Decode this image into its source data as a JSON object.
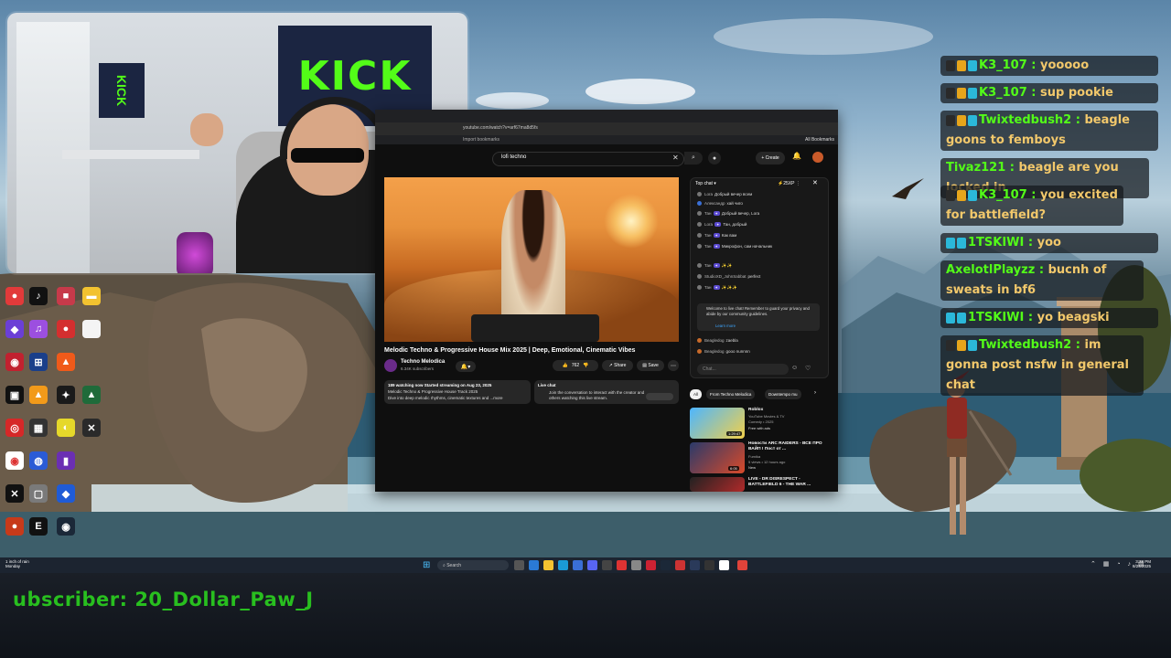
{
  "browser": {
    "url": "youtube.com/watch?v=arf67ma8d5fs",
    "bookmarks_text": "Import bookmarks",
    "all_bookmarks": "All Bookmarks"
  },
  "youtube": {
    "search_value": "lofi techno",
    "create_label": "Create",
    "video_title": "Melodic Techno & Progressive House Mix 2025 | Deep, Emotional, Cinematic Vibes",
    "channel_name": "Techno Melodica",
    "subscribers": "6.34K subscribers",
    "like_count": "762",
    "share_label": "Share",
    "save_label": "Save",
    "description": {
      "line1": "189 watching now  Started streaming on Aug 23, 2025",
      "line2": "Melodic Techno & Progressive House Track 2025",
      "line3": "Dive into deep melodic rhythms, cinematic textures and ...more"
    },
    "live_chat_box": {
      "title": "Live chat",
      "text": "Join the conversation to interact with the creator and others watching this live stream."
    },
    "chat": {
      "header": "Top chat",
      "xp": "25XP",
      "messages": [
        {
          "name": "Lora",
          "text": "Добрый вечер всем"
        },
        {
          "name": "Александр",
          "text": "хай чиго"
        },
        {
          "name": "Тан",
          "text": "Добрый вечер, Lora"
        },
        {
          "name": "Lora",
          "text": "Тан, добрый"
        },
        {
          "name": "Тан",
          "text": "Как вам"
        },
        {
          "name": "Тан",
          "text": "Микрофон, сам начальник"
        },
        {
          "name": "Тан",
          "text": "✨✨"
        },
        {
          "name": "StudioXD_JohnSabbat",
          "text": "perfect"
        },
        {
          "name": "Тан",
          "text": "✨✨✨"
        }
      ],
      "welcome": "Welcome to live chat! Remember to guard your privacy and abide by our community guidelines.",
      "learn_more": "Learn more",
      "bottom_messages": [
        {
          "name": "Beagledog",
          "text": "zaebla"
        },
        {
          "name": "Beagledog",
          "text": "gooo nunnnn"
        }
      ],
      "input_placeholder": "Chat..."
    },
    "chips": [
      "All",
      "From Techno Melodica",
      "Downtempo mu"
    ],
    "recommendations": [
      {
        "title": "Roblox",
        "meta1": "YouTube Movies & TV",
        "meta2": "Comedy • 2025",
        "meta3": "Free with ads",
        "duration": "1:29:47"
      },
      {
        "title": "Новости ARC RAIDERS - ВСЕ ПРО ВАЙП ! Пост от ...",
        "meta1": "Fumika",
        "meta2": "5 views • 12 hours ago",
        "meta3": "New",
        "duration": "6:05"
      },
      {
        "title": "LIVE - DR DISRESPECT - BATTLEFIELD 6 - THE WAR ...",
        "meta1": "",
        "meta2": "",
        "meta3": "",
        "duration": ""
      }
    ]
  },
  "stream_chat": [
    {
      "user": "K3_107",
      "msg": "yooooo"
    },
    {
      "user": "K3_107",
      "msg": "sup pookie"
    },
    {
      "user": "Twixtedbush2",
      "msg": "beagle goons to femboys"
    },
    {
      "user": "Tivaz121",
      "msg": "beagle are you locked in"
    },
    {
      "user": "K3_107",
      "msg": "you excited for battlefield?"
    },
    {
      "user": "1TSKIWI",
      "msg": "yoo"
    },
    {
      "user": "AxelotlPlayzz",
      "msg": "bucnh of sweats in bf6"
    },
    {
      "user": "1TSKIWI",
      "msg": "yo beagski"
    },
    {
      "user": "Twixtedbush2",
      "msg": "im gonna post nsfw in general chat"
    }
  ],
  "taskbar": {
    "weather_line1": "1 inch of rain",
    "weather_line2": "Monday",
    "search_label": "Search",
    "clock_time": "3:38 PM",
    "clock_date": "8/25/2025"
  },
  "webcam": {
    "banner_text": "KICK",
    "side_banner_text": "KICK"
  },
  "banner": {
    "text": "ubscriber: 20_Dollar_Paw_J"
  },
  "colors": {
    "kick_green": "#53fc18",
    "chat_msg": "#f2c86b",
    "youtube_bg": "#0f0f0f",
    "taskbar_bg": "#1c2430"
  }
}
